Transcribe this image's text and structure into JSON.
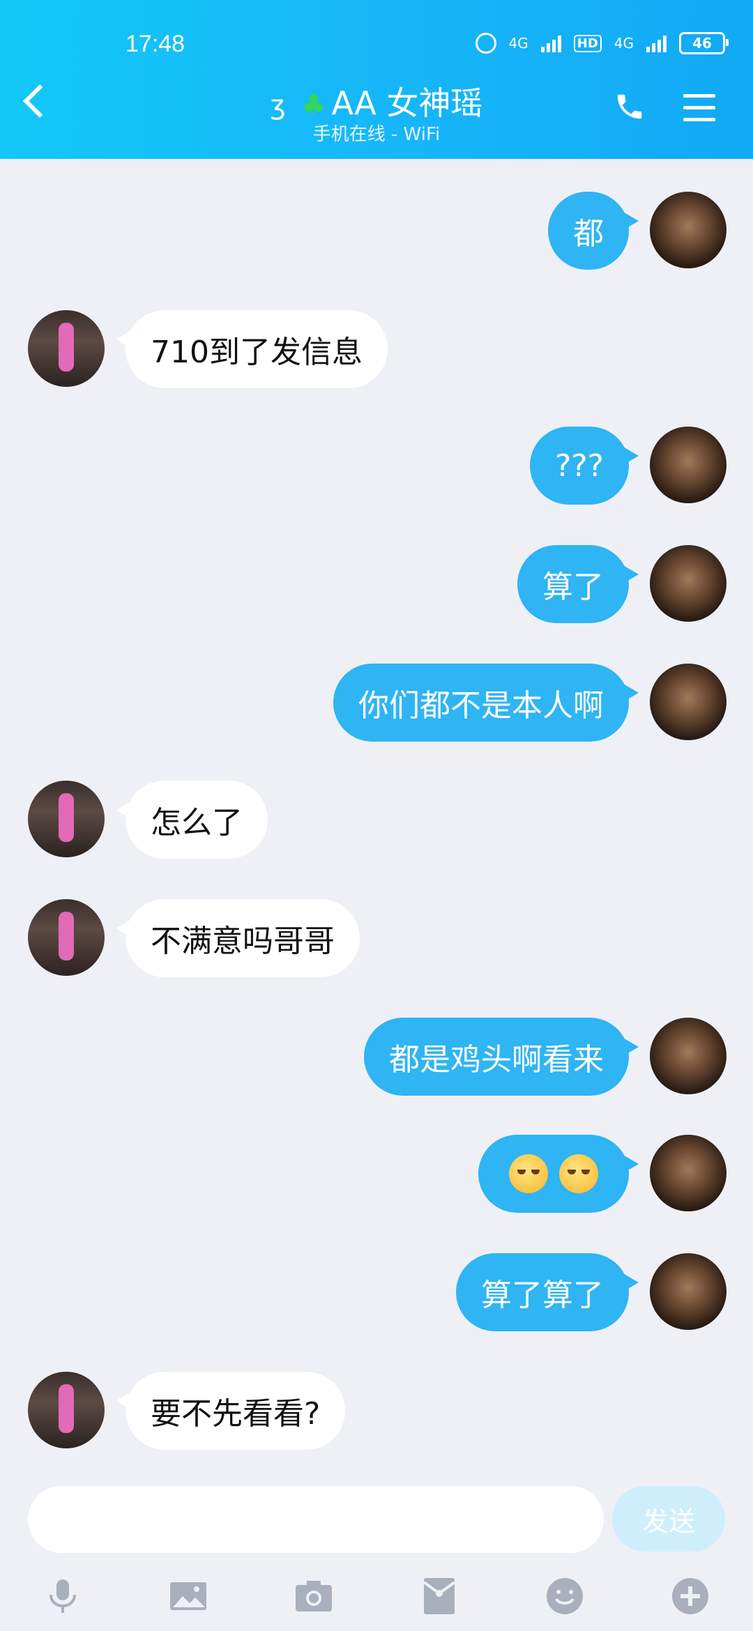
{
  "status": {
    "time": "17:48",
    "net1": "4G",
    "hd": "HD",
    "net2": "4G",
    "battery": "46"
  },
  "header": {
    "title": "AA  女神瑶",
    "subtitle": "手机在线 - WiFi"
  },
  "messages": [
    {
      "from": "me",
      "text": "都"
    },
    {
      "from": "her",
      "text": "710到了发信息"
    },
    {
      "from": "me",
      "text": "???"
    },
    {
      "from": "me",
      "text": "算了"
    },
    {
      "from": "me",
      "text": "你们都不是本人啊"
    },
    {
      "from": "her",
      "text": "怎么了"
    },
    {
      "from": "her",
      "text": "不满意吗哥哥"
    },
    {
      "from": "me",
      "text": "都是鸡头啊看来"
    },
    {
      "from": "me",
      "text": "pleading-face-emoji x2"
    },
    {
      "from": "me",
      "text": "算了算了"
    },
    {
      "from": "her",
      "text": "要不先看看?"
    }
  ],
  "composer": {
    "input_value": "",
    "send_label": "发送"
  },
  "icons": [
    "microphone-icon",
    "image-icon",
    "camera-icon",
    "red-packet-icon",
    "emoji-icon",
    "plus-icon"
  ],
  "colors": {
    "header": "#16b7f8",
    "my_bubble": "#2fb4f4",
    "background": "#eef0f6"
  }
}
